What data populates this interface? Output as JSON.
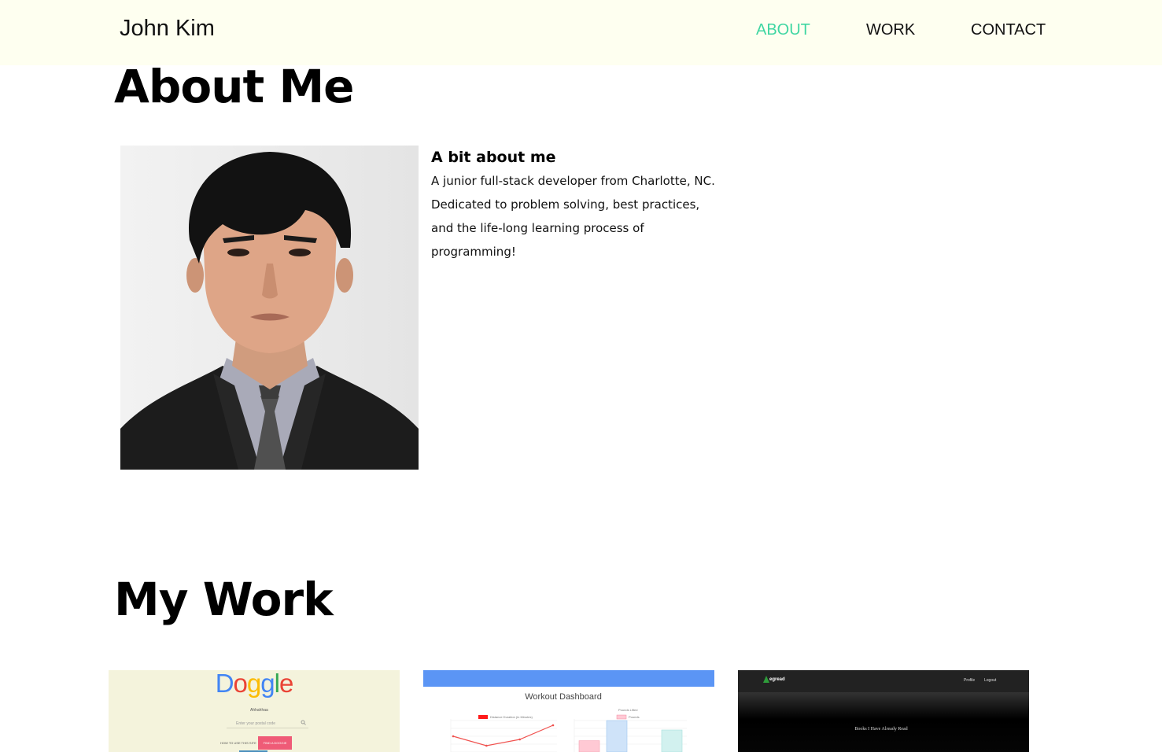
{
  "navbar": {
    "brand": "John Kim",
    "links": [
      {
        "label": "ABOUT",
        "active": true
      },
      {
        "label": "WORK",
        "active": false
      },
      {
        "label": "CONTACT",
        "active": false
      }
    ],
    "active_color": "#3fd6a2",
    "background": "#fefff0"
  },
  "about": {
    "title": "About Me",
    "portrait_icon": "profile-portrait",
    "bio_heading": "A bit about me",
    "bio_text": "A junior full-stack developer from Charlotte, NC. Dedicated to problem solving, best practices, and the life-long learning process of programming!"
  },
  "work": {
    "title": "My Work",
    "projects": [
      {
        "logo_letters": [
          "D",
          "o",
          "g",
          "g",
          "l",
          "e"
        ],
        "logo_colors": [
          "#4285f4",
          "#ea4335",
          "#fbbc05",
          "#4285f4",
          "#34a853",
          "#ea4335"
        ],
        "subtitle": "Ahhahhaa",
        "input_placeholder": "Enter your postal code",
        "search_icon": "search-icon",
        "left_link": "HOW TO USE THIS SITE",
        "button_label": "FIND A DOGGIE"
      },
      {
        "title": "Workout Dashboard",
        "legend_line": "Distance Duration (in Minutes)",
        "legend_bar": "Pounds Lifted",
        "legend_bar_label": "Pounds",
        "line_series": [
          {
            "x": 1,
            "y": 36
          },
          {
            "x": 2,
            "y": 24
          },
          {
            "x": 3,
            "y": 32
          },
          {
            "x": 4,
            "y": 50
          }
        ],
        "bar_series": [
          {
            "value": 18,
            "color": "#ffc9d4"
          },
          {
            "value": 50,
            "color": "#cfe3f9"
          },
          {
            "value": 35,
            "color": "#d2f1ef"
          }
        ]
      },
      {
        "brand": "egread",
        "tree_icon": "tree-icon",
        "links": [
          "Profile",
          "Logout"
        ],
        "heading": "Books I Have Already Read"
      }
    ]
  }
}
